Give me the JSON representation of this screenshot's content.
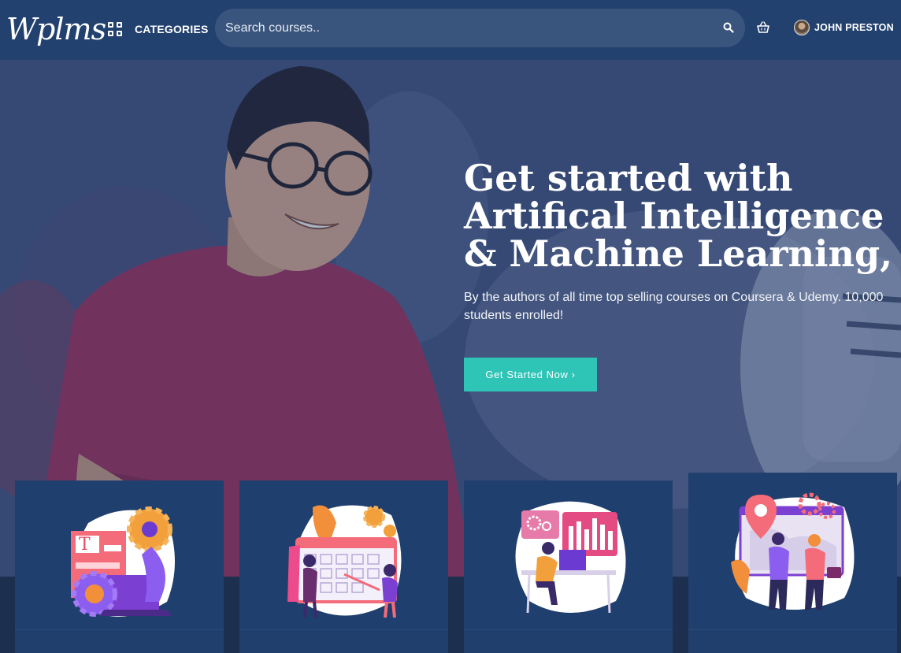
{
  "header": {
    "logo_text": "Wplms",
    "categories_label": "CATEGORIES",
    "search_placeholder": "Search courses..",
    "user_name": "JOHN PRESTON"
  },
  "hero": {
    "title": "Get started with Artifical Intelligence & Machine Learning,",
    "subtitle": "By the authors of all time top selling courses on Coursera & Udemy. 10,000 students enrolled!",
    "cta_label": "Get Started Now ›"
  },
  "cards": [
    {
      "icon": "design-illustration-icon",
      "title": ""
    },
    {
      "icon": "calendar-planning-illustration-icon",
      "title": ""
    },
    {
      "icon": "analytics-workstation-illustration-icon",
      "title": ""
    },
    {
      "icon": "business-deal-illustration-icon",
      "title": ""
    }
  ],
  "colors": {
    "header_bg": "#22416e",
    "cta": "#2ec4b6",
    "card_bg": "#1f3f6e"
  }
}
